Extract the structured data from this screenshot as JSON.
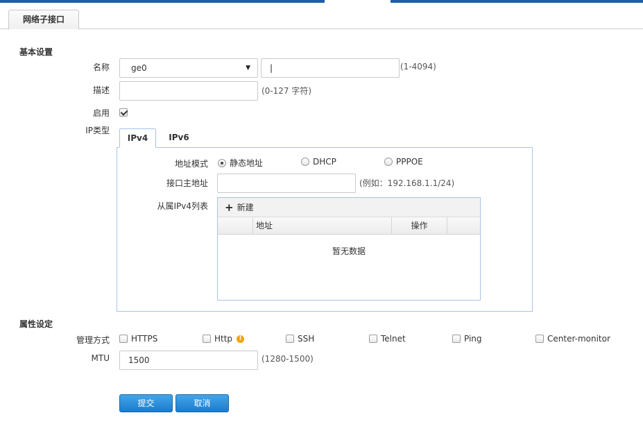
{
  "page_tab": "网络子接口",
  "basic": {
    "section_title": "基本设置",
    "name_label": "名称",
    "interface_value": "ge0",
    "vlan_value": "|",
    "vlan_hint": "(1-4094)",
    "desc_label": "描述",
    "desc_value": "",
    "desc_hint": "(0-127 字符)",
    "enable_label": "启用",
    "enable_checked": true,
    "ip_type_label": "IP类型",
    "ip_tabs": [
      "IPv4",
      "IPv6"
    ],
    "addr_mode_label": "地址模式",
    "addr_modes": [
      "静态地址",
      "DHCP",
      "PPPOE"
    ],
    "main_addr_label": "接口主地址",
    "main_addr_value": "",
    "main_addr_hint": "(例如：192.168.1.1/24)",
    "secondary_label": "从属IPv4列表",
    "new_button": "新建",
    "col_address": "地址",
    "col_action": "操作",
    "empty_text": "暂无数据"
  },
  "attr": {
    "section_title": "属性设定",
    "mgmt_label": "管理方式",
    "mgmt_options": [
      "HTTPS",
      "Http",
      "SSH",
      "Telnet",
      "Ping",
      "Center-monitor"
    ],
    "mtu_label": "MTU",
    "mtu_value": "1500",
    "mtu_hint": "(1280-1500)"
  },
  "actions": {
    "submit": "提交",
    "cancel": "取消"
  },
  "colors": {
    "accent": "#1d5fa8",
    "button": "#2a8bd8",
    "tab_border": "#a9c4e4",
    "warning": "#f0a20c"
  },
  "icons": [
    "caret-down-icon",
    "checkbox-icon",
    "radio-icon",
    "plus-icon",
    "warning-icon"
  ]
}
